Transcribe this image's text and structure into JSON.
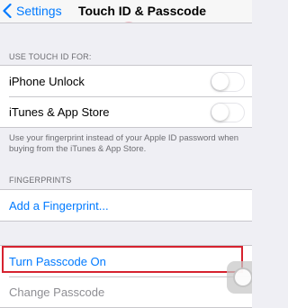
{
  "navbar": {
    "back_label": "Settings",
    "title": "Touch ID & Passcode"
  },
  "touch_id": {
    "header": "USE TOUCH ID FOR:",
    "items": [
      {
        "label": "iPhone Unlock",
        "enabled": false
      },
      {
        "label": "iTunes & App Store",
        "enabled": false
      }
    ],
    "footer": "Use your fingerprint instead of your Apple ID password when buying from the iTunes & App Store."
  },
  "fingerprints": {
    "header": "FINGERPRINTS",
    "add_label": "Add a Fingerprint..."
  },
  "passcode": {
    "turn_on_label": "Turn Passcode On",
    "change_label": "Change Passcode"
  },
  "colors": {
    "accent": "#007aff",
    "highlight": "#d6222f",
    "background": "#efeff4"
  },
  "icons": {
    "back": "chevron-left-icon",
    "fingerprint": "fingerprint-icon",
    "assistive_touch": "assistive-touch-icon"
  }
}
